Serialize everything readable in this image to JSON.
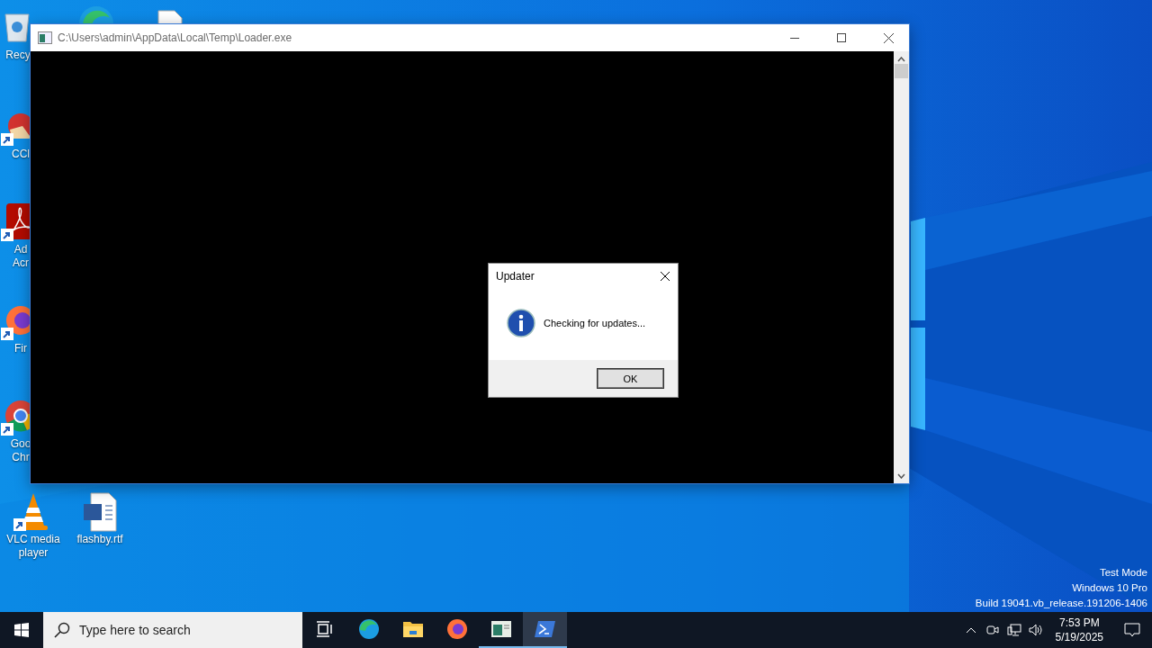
{
  "desktop": {
    "icons": [
      {
        "kind": "recycle-bin",
        "shortcut": false,
        "label_lines": [
          "Recy"
        ]
      },
      {
        "kind": "edge"
      },
      {
        "kind": "document"
      },
      {
        "kind": "ccleaner",
        "shortcut": true,
        "label_lines": [
          "CCl"
        ]
      },
      {
        "kind": "acrobat",
        "shortcut": true,
        "label_lines": [
          "Ad",
          "Acr"
        ]
      },
      {
        "kind": "firefox",
        "shortcut": true,
        "label_lines": [
          "Fir"
        ]
      },
      {
        "kind": "chrome",
        "shortcut": true,
        "label_lines": [
          "Goo",
          "Chr"
        ]
      },
      {
        "kind": "vlc",
        "shortcut": true,
        "label_lines": [
          "VLC media",
          "player"
        ]
      },
      {
        "kind": "word",
        "shortcut": false,
        "label_lines": [
          "flashby.rtf"
        ]
      }
    ]
  },
  "window": {
    "title": "C:\\Users\\admin\\AppData\\Local\\Temp\\Loader.exe"
  },
  "dialog": {
    "title": "Updater",
    "message": "Checking for updates...",
    "buttons": [
      "OK"
    ]
  },
  "watermark": [
    "Test Mode",
    "Windows 10 Pro",
    "Build 19041.vb_release.191206-1406"
  ],
  "taskbar": {
    "search": {
      "placeholder": "Type here to search"
    },
    "apps": [
      {
        "kind": "task-view",
        "running": false,
        "selected": false
      },
      {
        "kind": "edge",
        "running": false,
        "selected": false
      },
      {
        "kind": "explorer",
        "running": false,
        "selected": false
      },
      {
        "kind": "firefox",
        "running": false,
        "selected": false
      },
      {
        "kind": "console",
        "running": true,
        "selected": false
      },
      {
        "kind": "powershell",
        "running": true,
        "selected": true
      }
    ],
    "time": "7:53 PM",
    "date": "5/19/2025"
  }
}
